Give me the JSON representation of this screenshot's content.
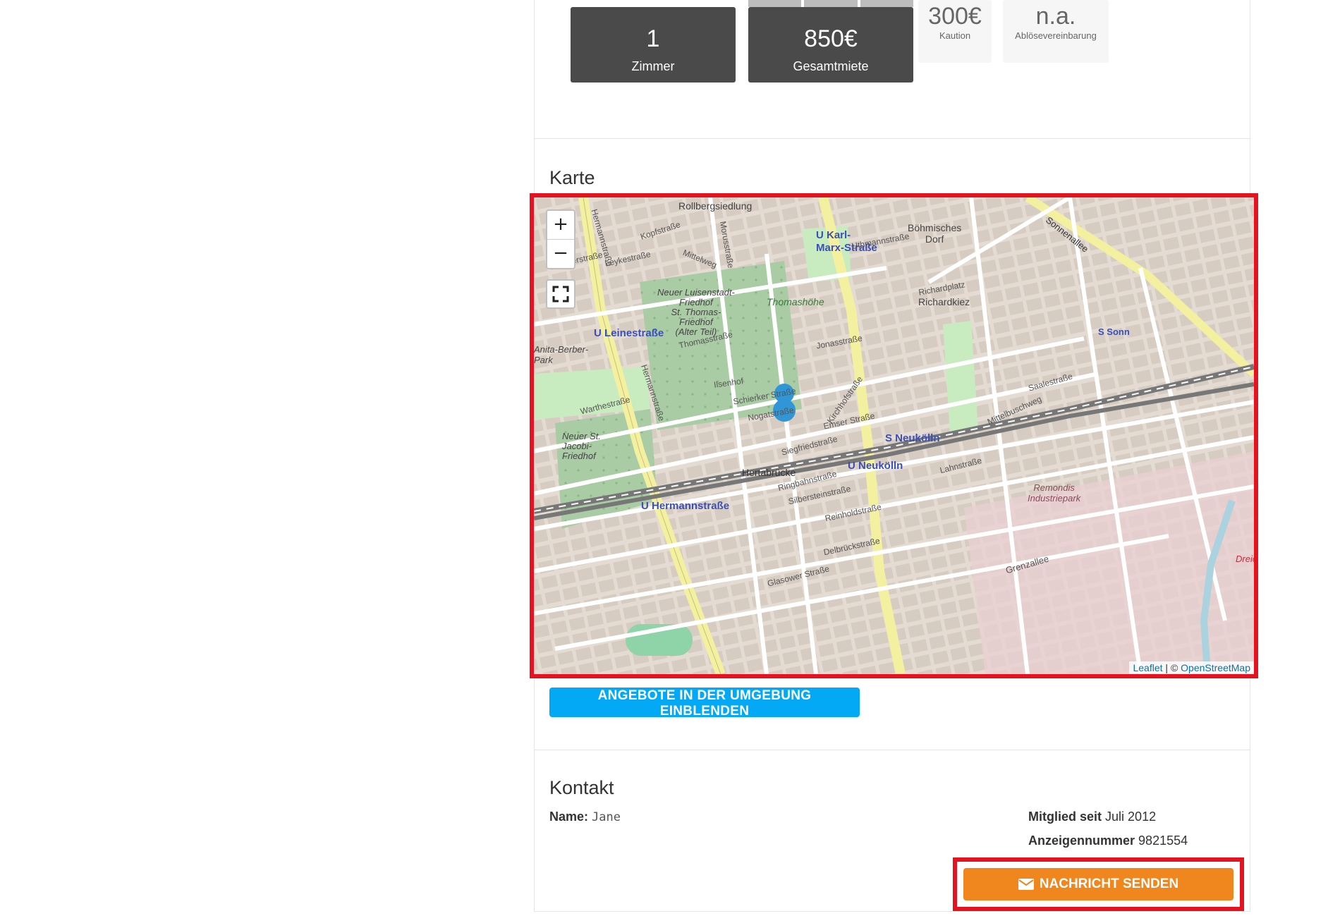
{
  "stats": {
    "rooms": {
      "value": "1",
      "label": "Zimmer"
    },
    "rent": {
      "value": "850€",
      "label": "Gesamtmiete"
    },
    "deposit": {
      "value": "300€",
      "label": "Kaution"
    },
    "transfer": {
      "value": "n.a.",
      "label": "Ablösevereinbarung"
    }
  },
  "map_section": {
    "title": "Karte",
    "zoom_in": "+",
    "zoom_out": "−",
    "attribution_leaflet": "Leaflet",
    "attribution_sep": " | © ",
    "attribution_osm": "OpenStreetMap",
    "labels": {
      "rollbergsiedlung": "Rollbergsiedlung",
      "u_karl_marx": "U Karl-\nMarx-Straße",
      "boehmisches_dorf": "Böhmisches\nDorf",
      "sonnenallee": "Sonnenallee",
      "richardkiez": "Richardkiez",
      "u_leinestrasse": "U Leinestraße",
      "neuer_luisenstadt": "Neuer Luisenstadt-\nFriedhof\nSt. Thomas-\nFriedhof\n(Alter Teil)",
      "thomashoehe": "Thomashöhe",
      "s_neukoelln": "S Neukölln",
      "u_neukoelln": "U Neukölln",
      "hertabruecke": "Hertabrücke",
      "u_hermannstrasse": "U Hermannstraße",
      "remondis": "Remondis\nIndustriepark",
      "grenzallee": "Grenzallee",
      "hermannstrasse": "Hermannstraße",
      "jonasstrasse": "Jonasstraße",
      "emser_strasse": "Emser Straße",
      "silbersteinstrasse": "Silbersteinstraße",
      "lahnstrasse": "Lahnstraße",
      "thomasstrasse": "Thomasstraße",
      "warthestrasse": "Warthestraße",
      "neuer_st_jacobi": "Neuer St.\nJacobi-\nFriedhof",
      "s_sonnenallee": "S Sonn",
      "saalestrasse": "Saalestraße",
      "mittelbuschweg": "Mittelbuschweg",
      "richardplatz": "Richardplatz",
      "kirchhofstrasse": "Kirchhofstraße",
      "nogatstrasse": "Nogatstraße",
      "ilsenhof": "Ilsenhof",
      "schierker_strasse": "Schierker Straße",
      "siegfriedstrasse": "Siegfriedstraße",
      "uthmannstrasse": "Uthmannstraße",
      "mittelweg": "Mittelweg",
      "kopfstrasse": "Kopfstraße",
      "leykestrasse": "Leykestraße",
      "allerstrasse": "Allerstraße",
      "morusstrasse": "Morusstraße",
      "ringbahnstrasse": "Ringbahnstraße",
      "reinholdstrasse": "Reinholdstraße",
      "delbrueckstrasse": "Delbrückstraße",
      "glasower_strasse": "Glasower Straße",
      "berber_park": "Anita-Berber-\nPark",
      "dreie": "Dreie"
    }
  },
  "nearby_button": "ANGEBOTE IN DER UMGEBUNG EINBLENDEN",
  "contact": {
    "title": "Kontakt",
    "name_label": "Name:",
    "name_value": "Jane",
    "member_label": "Mitglied seit",
    "member_value": "Juli 2012",
    "ad_label": "Anzeigennummer",
    "ad_value": "9821554",
    "send_button": "NACHRICHT SENDEN"
  },
  "colors": {
    "accent_blue": "#03a9f4",
    "accent_orange": "#f0861e",
    "highlight_red": "#e5121f",
    "dark_tile": "#4a4a4a"
  }
}
